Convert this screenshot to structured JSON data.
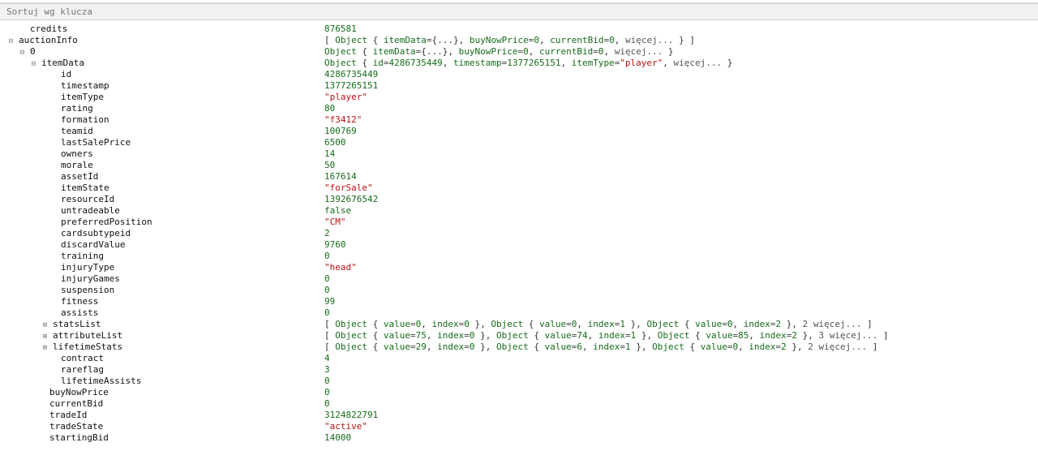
{
  "search": {
    "placeholder": "Sortuj wg klucza"
  },
  "root": {
    "credits": 876581,
    "auctionInfo": {
      "summary": "[ Object { itemData={...}, buyNowPrice=0, currentBid=0, więcej... } ]",
      "items": [
        {
          "label": "0",
          "summary": "Object { itemData={...}, buyNowPrice=0, currentBid=0, więcej... }",
          "itemData": {
            "summary": "Object { id=4286735449, timestamp=1377265151, itemType=\"player\", więcej... }",
            "id": 4286735449,
            "timestamp": 1377265151,
            "itemType": "player",
            "rating": 80,
            "formation": "f3412",
            "teamid": 100769,
            "lastSalePrice": 6500,
            "owners": 14,
            "morale": 50,
            "assetId": 167614,
            "itemState": "forSale",
            "resourceId": 1392676542,
            "untradeable": false,
            "preferredPosition": "CM",
            "cardsubtypeid": 2,
            "discardValue": 9760,
            "training": 0,
            "injuryType": "head",
            "injuryGames": 0,
            "suspension": 0,
            "fitness": 99,
            "assists": 0,
            "statsList": {
              "summary": "[ Object { value=0, index=0 }, Object { value=0, index=1 }, Object { value=0, index=2 }, 2 więcej... ]"
            },
            "attributeList": {
              "summary": "[ Object { value=75, index=0 }, Object { value=74, index=1 }, Object { value=85, index=2 }, 3 więcej... ]"
            },
            "lifetimeStats": {
              "summary": "[ Object { value=29, index=0 }, Object { value=6, index=1 }, Object { value=0, index=2 }, 2 więcej... ]"
            },
            "contract": 4,
            "rareflag": 3,
            "lifetimeAssists": 0
          },
          "buyNowPrice": 0,
          "currentBid": 0,
          "tradeId": 3124822791,
          "tradeState": "active",
          "startingBid": 14000
        }
      ]
    }
  },
  "labels": {
    "credits": "credits",
    "auctionInfo": "auctionInfo",
    "idx0": "0",
    "itemData": "itemData",
    "id": "id",
    "timestamp": "timestamp",
    "itemType": "itemType",
    "rating": "rating",
    "formation": "formation",
    "teamid": "teamid",
    "lastSalePrice": "lastSalePrice",
    "owners": "owners",
    "morale": "morale",
    "assetId": "assetId",
    "itemState": "itemState",
    "resourceId": "resourceId",
    "untradeable": "untradeable",
    "preferredPosition": "preferredPosition",
    "cardsubtypeid": "cardsubtypeid",
    "discardValue": "discardValue",
    "training": "training",
    "injuryType": "injuryType",
    "injuryGames": "injuryGames",
    "suspension": "suspension",
    "fitness": "fitness",
    "assists": "assists",
    "statsList": "statsList",
    "attributeList": "attributeList",
    "lifetimeStats": "lifetimeStats",
    "contract": "contract",
    "rareflag": "rareflag",
    "lifetimeAssists": "lifetimeAssists",
    "buyNowPrice": "buyNowPrice",
    "currentBid": "currentBid",
    "tradeId": "tradeId",
    "tradeState": "tradeState",
    "startingBid": "startingBid"
  }
}
